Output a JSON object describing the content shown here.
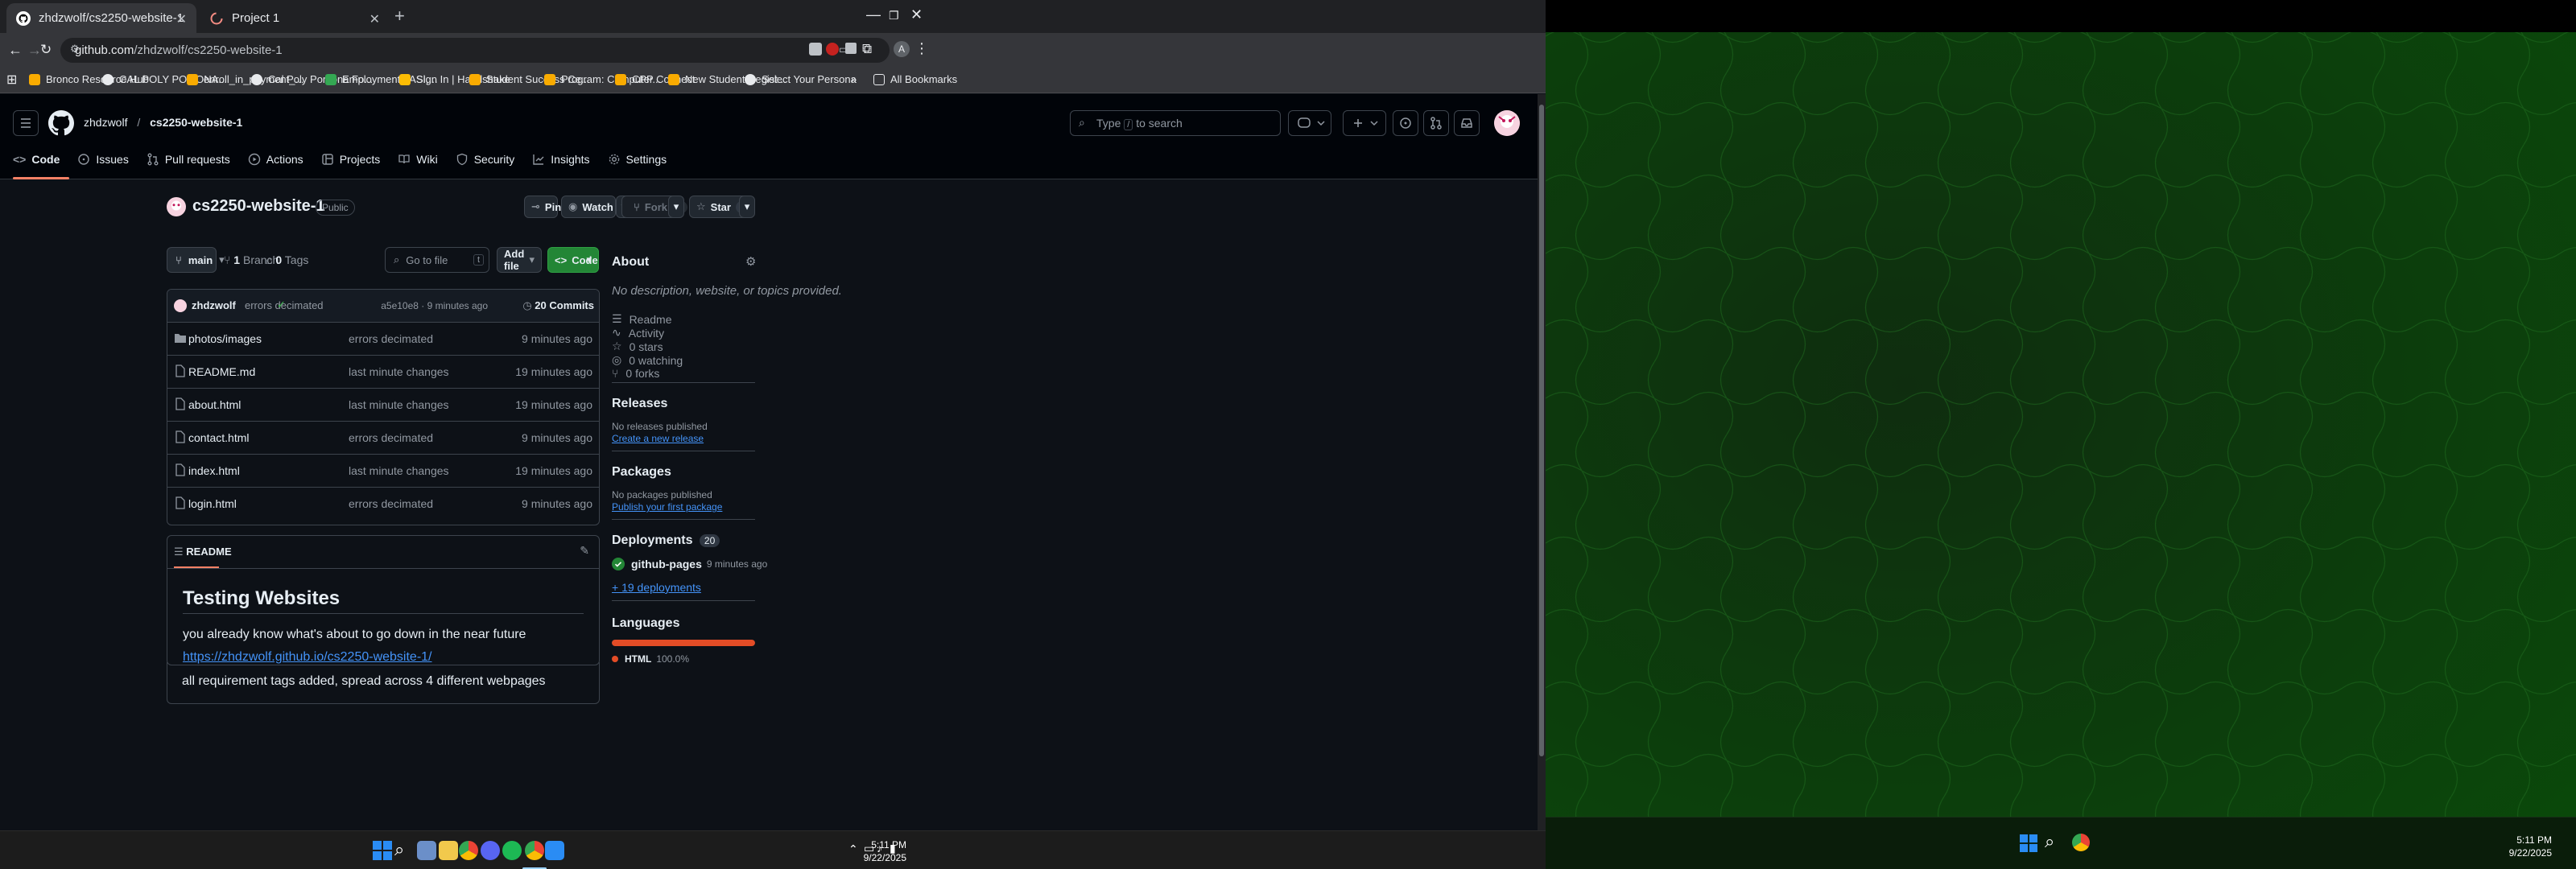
{
  "browser": {
    "tabs": [
      {
        "title": "zhdzwolf/cs2250-website-1"
      },
      {
        "title": "Project 1"
      }
    ],
    "url_host": "github.com",
    "url_path": "/zhdzwolf/cs2250-website-1",
    "profile_initial": "A",
    "bookmarks": [
      "Bronco Resource Hub",
      "CAL POLY POMONA...",
      "enroll_in_payment_...",
      "Cal Poly Pomona Fo...",
      "Employment - ASI,...",
      "Sign In | Handshake",
      "Student Success Ce...",
      "Program: Computer...",
      "CPP Connect",
      "New Student Regist...",
      "Select Your Persona"
    ],
    "bookmarks_more": "»",
    "all_bookmarks": "All Bookmarks"
  },
  "github": {
    "owner": "zhdzwolf",
    "repo": "cs2250-website-1",
    "search_placeholder_pre": "Type",
    "search_key": "/",
    "search_placeholder_post": "to search",
    "nav": [
      "Code",
      "Issues",
      "Pull requests",
      "Actions",
      "Projects",
      "Wiki",
      "Security",
      "Insights",
      "Settings"
    ],
    "visibility": "Public",
    "pin": "Pin",
    "watch": "Watch",
    "watch_count": "0",
    "fork": "Fork",
    "fork_count": "0",
    "star": "Star",
    "star_count": "0",
    "branch": "main",
    "branches_count": "1",
    "branches_label": "Branch",
    "tags_count": "0",
    "tags_label": "Tags",
    "go_to_file": "Go to file",
    "go_to_file_key": "t",
    "add_file": "Add file",
    "code_btn": "Code",
    "commit": {
      "author": "zhdzwolf",
      "message": "errors decimated",
      "hash_time": "a5e10e8 · 9 minutes ago",
      "commits_count": "20",
      "commits_label": "Commits"
    },
    "files": [
      {
        "name": "photos/images",
        "message": "errors decimated",
        "time": "9 minutes ago",
        "type": "folder"
      },
      {
        "name": "README.md",
        "message": "last minute changes",
        "time": "19 minutes ago",
        "type": "file"
      },
      {
        "name": "about.html",
        "message": "last minute changes",
        "time": "19 minutes ago",
        "type": "file"
      },
      {
        "name": "contact.html",
        "message": "errors decimated",
        "time": "9 minutes ago",
        "type": "file"
      },
      {
        "name": "index.html",
        "message": "last minute changes",
        "time": "19 minutes ago",
        "type": "file"
      },
      {
        "name": "login.html",
        "message": "errors decimated",
        "time": "9 minutes ago",
        "type": "file"
      }
    ],
    "readme": {
      "tab": "README",
      "heading": "Testing Websites",
      "p1": "you already know what's about to go down in the near future",
      "link": "https://zhdzwolf.github.io/cs2250-website-1/",
      "p2": "all requirement tags added, spread across 4 different webpages"
    },
    "about": {
      "title": "About",
      "desc": "No description, website, or topics provided.",
      "items": [
        "Readme",
        "Activity",
        "0 stars",
        "0 watching",
        "0 forks"
      ]
    },
    "releases": {
      "title": "Releases",
      "none": "No releases published",
      "create": "Create a new release"
    },
    "packages": {
      "title": "Packages",
      "none": "No packages published",
      "publish": "Publish your first package"
    },
    "deployments": {
      "title": "Deployments",
      "count": "20",
      "name": "github-pages",
      "time": "9 minutes ago",
      "more": "+ 19 deployments"
    },
    "languages": {
      "title": "Languages",
      "name": "HTML",
      "percent": "100.0%",
      "percent_value": 100,
      "color": "#e34c26"
    }
  },
  "taskbar": {
    "time": "5:11 PM",
    "date": "9/22/2025"
  }
}
